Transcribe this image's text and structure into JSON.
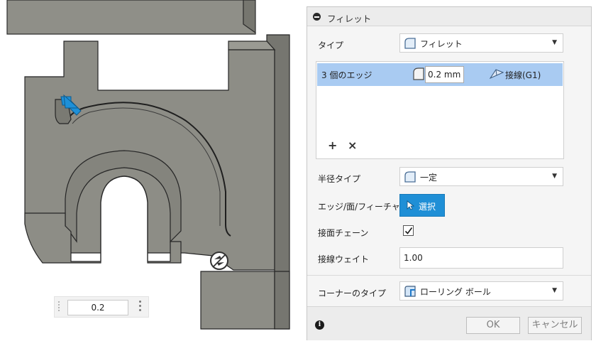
{
  "viewport": {
    "value_input": "0.2"
  },
  "dialog": {
    "title": "フィレット",
    "type": {
      "label": "タイプ",
      "value": "フィレット"
    },
    "edges": {
      "row_label": "3 個のエッジ",
      "radius": "0.2 mm",
      "tangency": "接線(G1)",
      "add_symbol": "+",
      "remove_symbol": "×"
    },
    "radius_type": {
      "label": "半径タイプ",
      "value": "一定"
    },
    "selection": {
      "label": "エッジ/面/フィーチャ",
      "button": "選択"
    },
    "tangent_chain": {
      "label": "接面チェーン",
      "checked": true
    },
    "tangency_weight": {
      "label": "接線ウェイト",
      "value": "1.00"
    },
    "corner_type": {
      "label": "コーナーのタイプ",
      "value": "ローリング ボール"
    },
    "footer": {
      "ok": "OK",
      "cancel": "キャンセル"
    }
  },
  "icons": {
    "collapse": "collapse-icon",
    "fillet": "fillet-icon",
    "radius": "radius-icon",
    "tangent": "tangent-icon",
    "cursor": "cursor-icon",
    "check": "check-icon",
    "info": "info-icon",
    "corner": "corner-icon",
    "direction_arrow": "direction-arrow-icon",
    "manipulator": "manipulator-icon"
  },
  "colors": {
    "selection_row": "#a9cbf2",
    "select_button": "#1f8fd6",
    "model_face": "#8d8d86",
    "model_side": "#7a7a73",
    "arrow": "#1e90d8"
  }
}
